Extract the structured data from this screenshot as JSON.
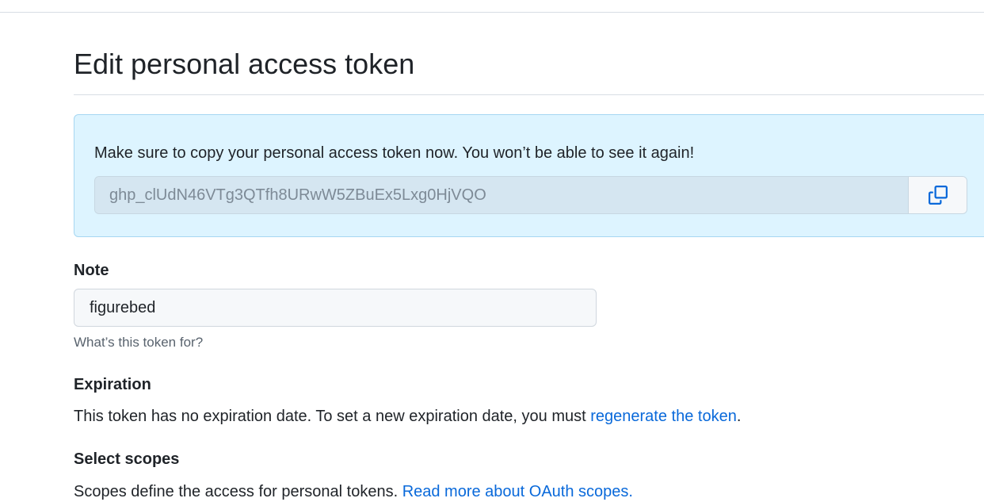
{
  "header": {
    "title": "Edit personal access token"
  },
  "flash": {
    "message": "Make sure to copy your personal access token now. You won’t be able to see it again!",
    "token": "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",
    "copy_icon": "copy-icon"
  },
  "note": {
    "label": "Note",
    "value": "figurebed",
    "hint": "What’s this token for?"
  },
  "expiration": {
    "label": "Expiration",
    "text_before": "This token has no expiration date. To set a new expiration date, you must ",
    "link_text": "regenerate the token",
    "text_after": "."
  },
  "scopes": {
    "label": "Select scopes",
    "text_before": "Scopes define the access for personal tokens. ",
    "link_text": "Read more about OAuth scopes."
  },
  "colors": {
    "link": "#0969da",
    "flash_background": "#ddf4ff",
    "flash_border": "#a6d7f2"
  }
}
